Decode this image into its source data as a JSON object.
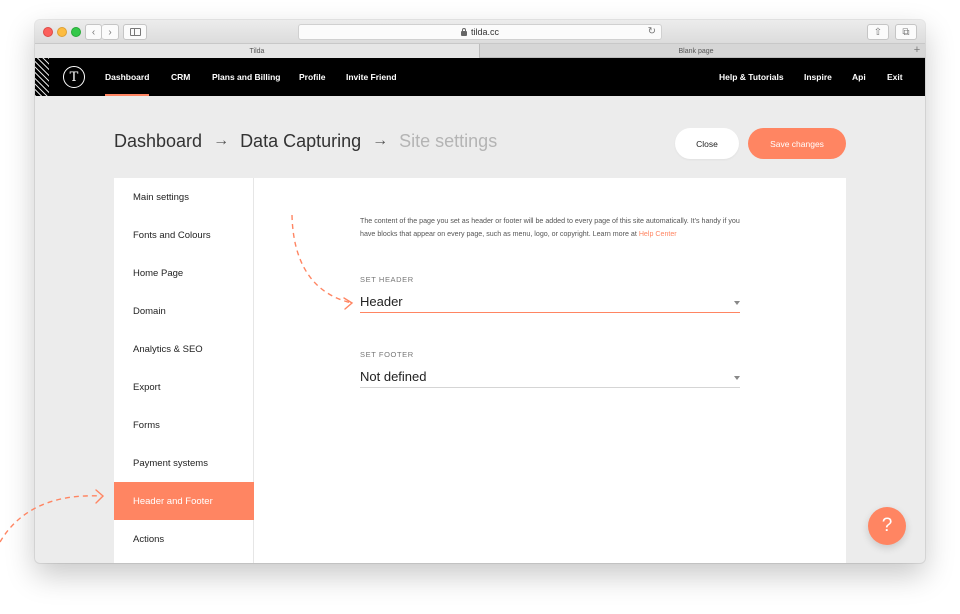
{
  "browser": {
    "url": "tilda.cc",
    "tabs": [
      {
        "label": "Tilda"
      },
      {
        "label": "Blank page"
      }
    ],
    "add_tab": "+"
  },
  "topnav": {
    "logo_letter": "T",
    "left_items": [
      {
        "label": "Dashboard"
      },
      {
        "label": "CRM"
      },
      {
        "label": "Plans and Billing"
      },
      {
        "label": "Profile"
      },
      {
        "label": "Invite Friend"
      }
    ],
    "right_items": [
      {
        "label": "Help & Tutorials"
      },
      {
        "label": "Inspire"
      },
      {
        "label": "Api"
      },
      {
        "label": "Exit"
      }
    ]
  },
  "breadcrumb": {
    "items": [
      "Dashboard",
      "Data Capturing",
      "Site settings"
    ],
    "separator": "→"
  },
  "actions": {
    "close_label": "Close",
    "save_label": "Save changes"
  },
  "sidebar": {
    "items": [
      {
        "label": "Main settings"
      },
      {
        "label": "Fonts and Colours"
      },
      {
        "label": "Home Page"
      },
      {
        "label": "Domain"
      },
      {
        "label": "Analytics & SEO"
      },
      {
        "label": "Export"
      },
      {
        "label": "Forms"
      },
      {
        "label": "Payment systems"
      },
      {
        "label": "Header and Footer"
      },
      {
        "label": "Actions"
      }
    ],
    "active": "Header and Footer"
  },
  "content": {
    "description": "The content of the page you set as header or footer will be added to every page of this site automatically. It's handy if you have blocks that appear on every page, such as menu, logo, or copyright. Learn more at",
    "help_link": "Help Center",
    "header_label": "SET HEADER",
    "header_value": "Header",
    "footer_label": "SET FOOTER",
    "footer_value": "Not defined"
  },
  "help_fab": "?",
  "colors": {
    "accent": "#ff8562",
    "nav_bg": "#000000",
    "page_bg": "#ececec"
  }
}
